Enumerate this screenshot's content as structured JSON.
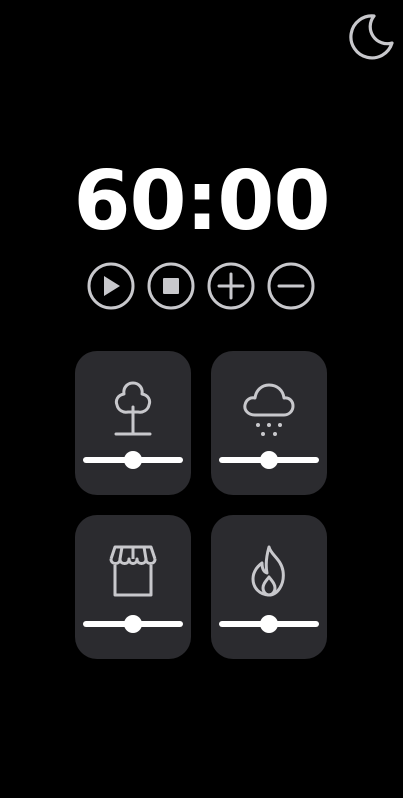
{
  "timer": {
    "display": "60:00"
  },
  "controls": [
    {
      "icon": "play-icon"
    },
    {
      "icon": "stop-icon"
    },
    {
      "icon": "plus-icon"
    },
    {
      "icon": "minus-icon"
    }
  ],
  "header": {
    "theme_toggle_icon": "moon-icon"
  },
  "sounds": [
    {
      "icon": "tree-icon",
      "volume": 0.5
    },
    {
      "icon": "rain-cloud-icon",
      "volume": 0.5
    },
    {
      "icon": "storefront-icon",
      "volume": 0.5
    },
    {
      "icon": "fire-icon",
      "volume": 0.5
    }
  ],
  "colors": {
    "background": "#000000",
    "card": "#2b2b2f",
    "icon_stroke": "#c8c8cc",
    "text": "#ffffff"
  }
}
